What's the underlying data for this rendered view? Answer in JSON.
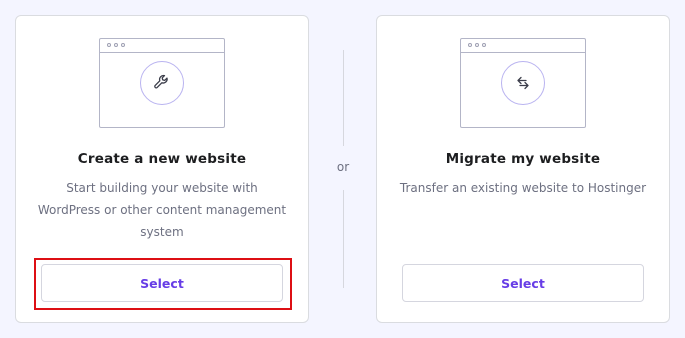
{
  "options": {
    "create": {
      "title": "Create a new website",
      "description": "Start building your website with WordPress or other content management system",
      "select_label": "Select",
      "icon": "wrench-icon"
    },
    "migrate": {
      "title": "Migrate my website",
      "description": "Transfer an existing website to Hostinger",
      "select_label": "Select",
      "icon": "arrows-swap-icon"
    }
  },
  "divider": {
    "label": "or"
  },
  "colors": {
    "accent": "#673de6",
    "highlight": "#dd0f14",
    "card_border": "#dadce0",
    "muted_text": "#6d7081"
  }
}
